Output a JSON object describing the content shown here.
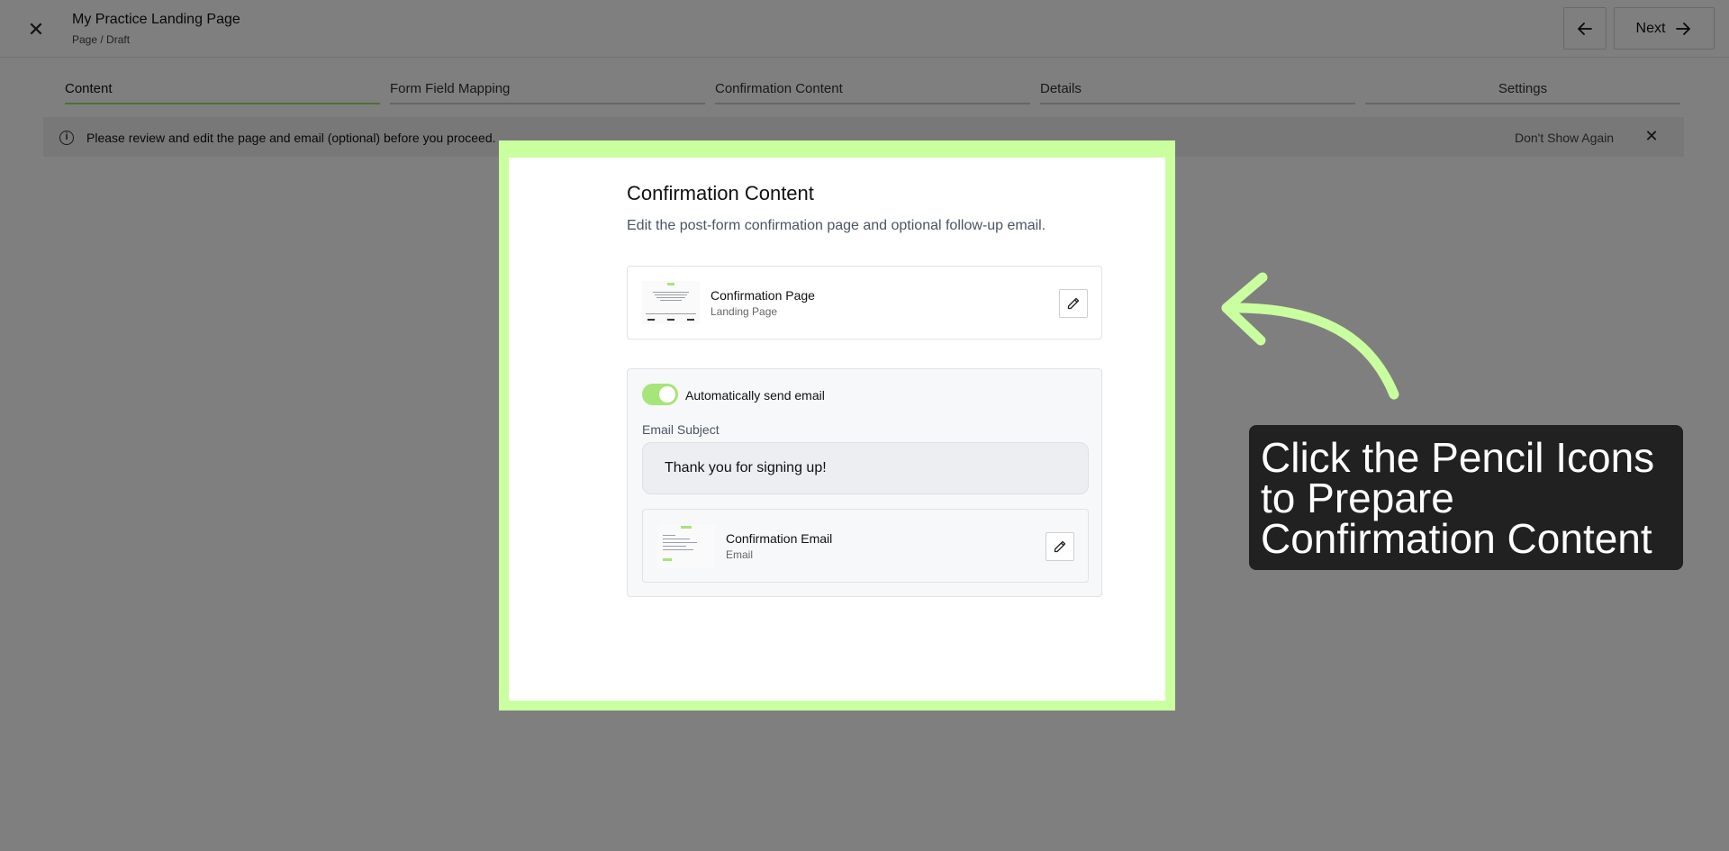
{
  "header": {
    "title": "My Practice Landing Page",
    "subtitle": "Page / Draft",
    "next_label": "Next"
  },
  "steps": [
    {
      "label": "Content",
      "active": true
    },
    {
      "label": "Form Field Mapping",
      "active": false
    },
    {
      "label": "Confirmation Content",
      "active": false
    },
    {
      "label": "Details",
      "active": false
    },
    {
      "label": "Settings",
      "active": false
    }
  ],
  "banner": {
    "message": "Please review and edit the page and email (optional) before you proceed.",
    "dont_show": "Don't Show Again"
  },
  "panel": {
    "title": "Confirmation Content",
    "subtitle": "Edit the post-form confirmation page and optional follow-up email.",
    "page_card": {
      "name": "Confirmation Page",
      "kind": "Landing Page"
    },
    "auto_email": {
      "label": "Automatically send email",
      "enabled": true
    },
    "email_subject": {
      "label": "Email Subject",
      "value": "Thank you for signing up!"
    },
    "email_card": {
      "name": "Confirmation Email",
      "kind": "Email"
    }
  },
  "callout": {
    "lines": [
      "Click the Pencil Icons",
      "to Prepare",
      "Confirmation Content"
    ]
  },
  "colors": {
    "accent_green": "#a6e57a",
    "highlight_green": "#caff9f",
    "callout_bg": "#212121"
  }
}
